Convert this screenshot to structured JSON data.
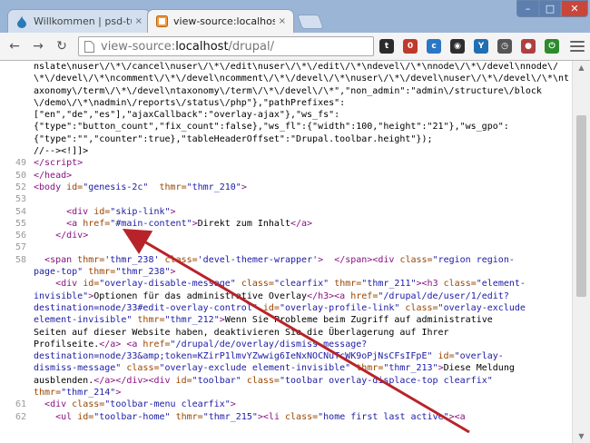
{
  "tabs": [
    {
      "title": "Willkommen | psd-tutorials",
      "favicon": "drupal-drop-icon",
      "close": "×"
    },
    {
      "title": "view-source:localhost/drupal/",
      "favicon": "source-page-icon",
      "close": "×"
    }
  ],
  "window_controls": {
    "minimize": "–",
    "maximize": "□",
    "close": "✕"
  },
  "nav": {
    "back": "←",
    "forward": "→",
    "reload": "↻"
  },
  "address": {
    "scheme": "view-source:",
    "host": "localhost",
    "path": "/drupal/"
  },
  "bookmark_star": "☆",
  "extensions": [
    {
      "name": "twitter-bird-icon",
      "label": "t",
      "color": "#2b2b2b"
    },
    {
      "name": "mail-counter-icon",
      "label": "0",
      "color": "#c0392b"
    },
    {
      "name": "cloud-icon",
      "label": "c",
      "color": "#2b77c6"
    },
    {
      "name": "camera-icon",
      "label": "◉",
      "color": "#2e2e2e"
    },
    {
      "name": "tree-icon",
      "label": "Y",
      "color": "#1f6fb2"
    },
    {
      "name": "clock-icon",
      "label": "◷",
      "color": "#555555"
    },
    {
      "name": "dot-icon",
      "label": "●",
      "color": "#b04040"
    },
    {
      "name": "power-icon",
      "label": "⏻",
      "color": "#2d8a2d"
    }
  ],
  "source_lines": [
    {
      "n": "",
      "html": "nslate\\nuser\\/\\*\\/cancel\\nuser\\/\\*\\/edit\\nuser\\/\\*\\/edit\\/\\*\\ndevel\\/\\*\\nnode\\/\\*\\/devel\\nnode\\/"
    },
    {
      "n": "",
      "html": "\\*\\/devel\\/\\*\\ncomment\\/\\*\\/devel\\ncomment\\/\\*\\/devel\\/\\*\\nuser\\/\\*\\/devel\\nuser\\/\\*\\/devel\\/\\*\\nt"
    },
    {
      "n": "",
      "html": "axonomy\\/term\\/\\*\\/devel\\ntaxonomy\\/term\\/\\*\\/devel\\/\\*\",\"non_admin\":\"admin\\/structure\\/block"
    },
    {
      "n": "",
      "html": "\\/demo\\/\\*\\nadmin\\/reports\\/status\\/php\"},\"pathPrefixes\":"
    },
    {
      "n": "",
      "html": "[\"en\",\"de\",\"es\"],\"ajaxCallback\":\"overlay-ajax\"},\"ws_fs\":"
    },
    {
      "n": "",
      "html": "{\"type\":\"button_count\",\"fix_count\":false},\"ws_fl\":{\"width\":100,\"height\":\"21\"},\"ws_gpo\":"
    },
    {
      "n": "",
      "html": "{\"type\":\"\",\"counter\":true},\"tableHeaderOffset\":\"Drupal.toolbar.height\"});"
    },
    {
      "n": "",
      "html": "//--&gt;&lt;!]]&gt;"
    },
    {
      "n": "49",
      "html": "<span class='t'>&lt;/script&gt;</span>"
    },
    {
      "n": "50",
      "html": "<span class='t'>&lt;/head&gt;</span>"
    },
    {
      "n": "52",
      "html": "<span class='t'>&lt;body </span><span class='a'>id=</span><span class='v'>\"genesis-2c\"</span>  <span class='a'>thmr=</span><span class='v'>\"thmr_210\"</span><span class='t'>&gt;</span>"
    },
    {
      "n": "53",
      "html": ""
    },
    {
      "n": "54",
      "html": "      <span class='t'>&lt;div </span><span class='a'>id=</span><span class='v'>\"skip-link\"</span><span class='t'>&gt;</span>"
    },
    {
      "n": "55",
      "html": "      <span class='t'>&lt;a </span><span class='a'>href=</span><span class='v'>\"#main-content\"</span><span class='t'>&gt;</span>Direkt zum Inhalt<span class='t'>&lt;/a&gt;</span>"
    },
    {
      "n": "56",
      "html": "    <span class='t'>&lt;/div&gt;</span>"
    },
    {
      "n": "57",
      "html": ""
    },
    {
      "n": "58",
      "html": "  <span class='t'>&lt;span </span><span class='a'>thmr=</span><span class='v'>'thmr_238'</span> <span class='a'>class=</span><span class='v'>'devel-themer-wrapper'</span><span class='t'>&gt;</span>  <span class='t'>&lt;/span&gt;&lt;div </span><span class='a'>class=</span><span class='v'>\"region region-</span>"
    },
    {
      "n": "",
      "html": "<span class='v'>page-top\"</span> <span class='a'>thmr=</span><span class='v'>\"thmr_238\"</span><span class='t'>&gt;</span>"
    },
    {
      "n": "",
      "html": "    <span class='t'>&lt;div </span><span class='a'>id=</span><span class='v'>\"overlay-disable-message\"</span> <span class='a'>class=</span><span class='v'>\"clearfix\"</span> <span class='a'>thmr=</span><span class='v'>\"thmr_211\"</span><span class='t'>&gt;&lt;h3 </span><span class='a'>class=</span><span class='v'>\"element-</span>"
    },
    {
      "n": "",
      "html": "<span class='v'>invisible\"</span><span class='t'>&gt;</span>Optionen für das administrative Overlay<span class='t'>&lt;/h3&gt;&lt;a </span><span class='a'>href=</span><span class='v'>\"/drupal/de/user/1/edit?</span>"
    },
    {
      "n": "",
      "html": "<span class='v'>destination=node/33#edit-overlay-control\"</span> <span class='a'>id=</span><span class='v'>\"overlay-profile-link\"</span> <span class='a'>class=</span><span class='v'>\"overlay-exclude</span>"
    },
    {
      "n": "",
      "html": "<span class='v'>element-invisible\"</span> <span class='a'>thmr=</span><span class='v'>\"thmr_212\"</span><span class='t'>&gt;</span>Wenn Sie Probleme beim Zugriff auf administrative"
    },
    {
      "n": "",
      "html": "Seiten auf dieser Website haben, deaktivieren Sie die Überlagerung auf Ihrer"
    },
    {
      "n": "",
      "html": "Profilseite.<span class='t'>&lt;/a&gt; &lt;a </span><span class='a'>href=</span><span class='v'>\"/drupal/de/overlay/dismiss-message?</span>"
    },
    {
      "n": "",
      "html": "<span class='v'>destination=node/33&amp;amp;token=KZirP1lmvYZwwig6IeNxNOCNuTcWK9oPjNsCFsIFpE\"</span> <span class='a'>id=</span><span class='v'>\"overlay-</span>"
    },
    {
      "n": "",
      "html": "<span class='v'>dismiss-message\"</span> <span class='a'>class=</span><span class='v'>\"overlay-exclude element-invisible\"</span> <span class='a'>thmr=</span><span class='v'>\"thmr_213\"</span><span class='t'>&gt;</span>Diese Meldung"
    },
    {
      "n": "",
      "html": "ausblenden.<span class='t'>&lt;/a&gt;&lt;/div&gt;&lt;div </span><span class='a'>id=</span><span class='v'>\"toolbar\"</span> <span class='a'>class=</span><span class='v'>\"toolbar overlay-displace-top clearfix\"</span>"
    },
    {
      "n": "",
      "html": "<span class='a'>thmr=</span><span class='v'>\"thmr_214\"</span><span class='t'>&gt;</span>"
    },
    {
      "n": "61",
      "html": "  <span class='t'>&lt;div </span><span class='a'>class=</span><span class='v'>\"toolbar-menu clearfix\"</span><span class='t'>&gt;</span>"
    },
    {
      "n": "62",
      "html": "    <span class='t'>&lt;ul </span><span class='a'>id=</span><span class='v'>\"toolbar-home\"</span> <span class='a'>thmr=</span><span class='v'>\"thmr_215\"</span><span class='t'>&gt;&lt;li </span><span class='a'>class=</span><span class='v'>\"home first last active\"</span><span class='t'>&gt;&lt;a</span>"
    }
  ],
  "annotation_color": "#b8232a"
}
